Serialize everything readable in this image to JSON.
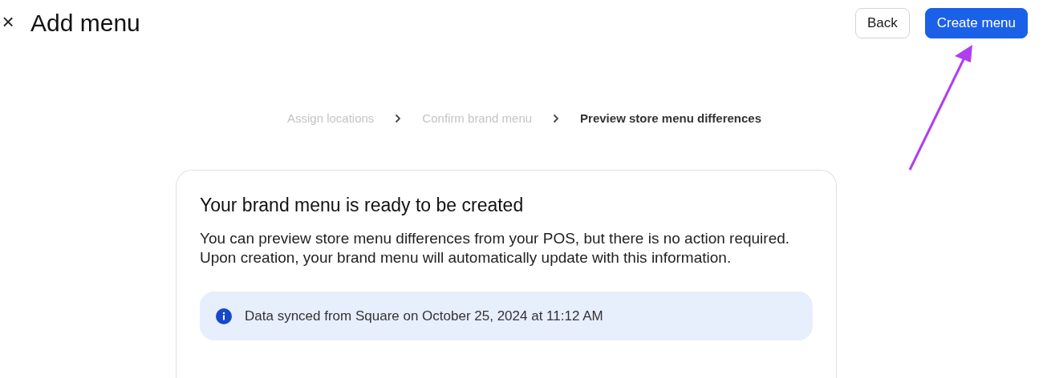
{
  "header": {
    "close": "×",
    "title": "Add menu",
    "buttons": [
      {
        "label": "Back",
        "kind": "secondary"
      },
      {
        "label": "Create menu",
        "kind": "primary"
      }
    ]
  },
  "steps": [
    {
      "label": "Assign locations",
      "selected": false
    },
    {
      "label": "Confirm brand menu",
      "selected": false
    },
    {
      "label": "Preview store menu differences",
      "selected": true
    }
  ],
  "card": {
    "title": "Your brand menu is ready to be created",
    "body": "You can preview store menu differences from your POS, but there is no action required. Upon creation, your brand menu will automatically update with this information.",
    "notice": "Data synced from Square on October 25, 2024 at 11:12 AM"
  },
  "annotation": {
    "kind": "arrow",
    "color": "#b03ef0"
  }
}
